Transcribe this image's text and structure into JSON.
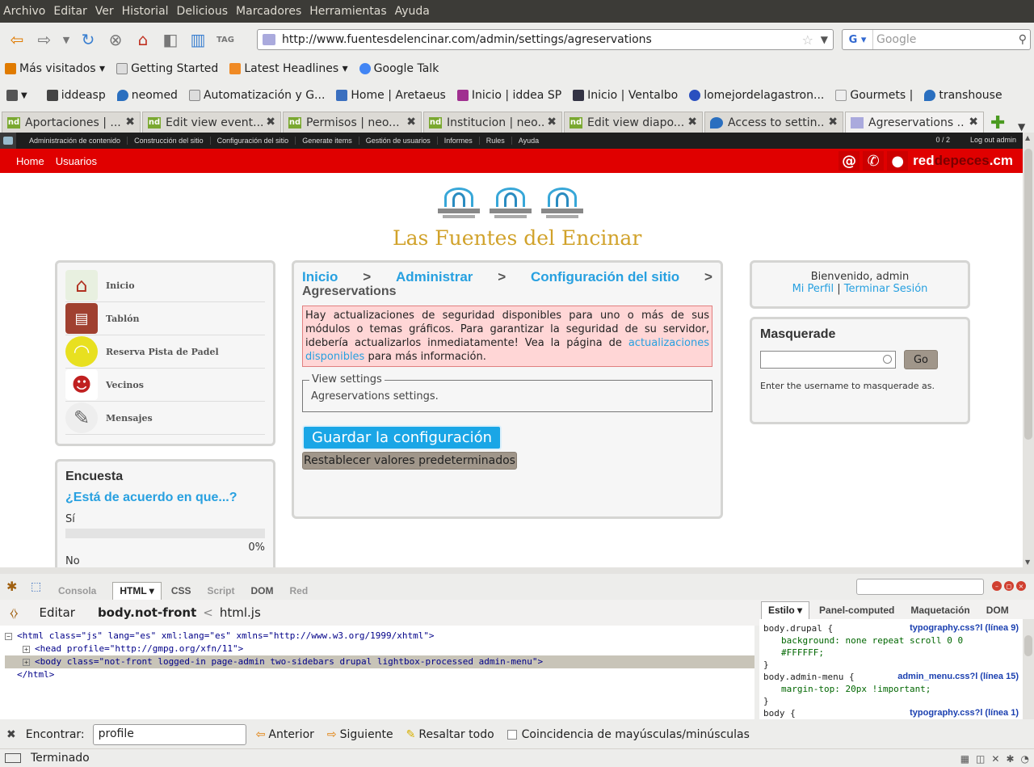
{
  "menubar": [
    "Archivo",
    "Editar",
    "Ver",
    "Historial",
    "Delicious",
    "Marcadores",
    "Herramientas",
    "Ayuda"
  ],
  "url": "http://www.fuentesdelencinar.com/admin/settings/agreservations",
  "search_placeholder": "Google",
  "bookmarks_row1": [
    "Más visitados ▾",
    "Getting Started",
    "Latest Headlines ▾",
    "Google Talk"
  ],
  "bookmarks_row2": [
    "iddeasp",
    "neomed",
    "Automatización y G...",
    "Home | Aretaeus",
    "Inicio | iddea SP",
    "Inicio | Ventalbo",
    "lomejordelagastron...",
    "Gourmets |",
    "transhouse"
  ],
  "tabs": [
    {
      "label": "Aportaciones | ...",
      "icon": "nd"
    },
    {
      "label": "Edit view event...",
      "icon": "nd"
    },
    {
      "label": "Permisos | neo...",
      "icon": "nd"
    },
    {
      "label": "Institucion | neo...",
      "icon": "nd"
    },
    {
      "label": "Edit view diapo...",
      "icon": "nd"
    },
    {
      "label": "Access to settin...",
      "icon": "drupal"
    },
    {
      "label": "Agreservations ...",
      "icon": "site"
    }
  ],
  "admin_menu": {
    "items": [
      "Administración de contenido",
      "Construcción del sitio",
      "Configuración del sitio",
      "Generate items",
      "Gestión de usuarios",
      "Informes",
      "Rules",
      "Ayuda"
    ],
    "user_count": "0 / 2",
    "logout": "Log out admin"
  },
  "red_nav": [
    "Home",
    "Usuarios"
  ],
  "brand": {
    "symbols": [
      "@",
      "✆",
      "●"
    ],
    "name_a": "red",
    "name_b": "depeces",
    "name_c": ".c",
    "name_d": "m"
  },
  "site_name": "Las Fuentes del Encinar",
  "left_nav": [
    "Inicio",
    "Tablón",
    "Reserva Pista de Padel",
    "Vecinos",
    "Mensajes"
  ],
  "poll": {
    "title": "Encuesta",
    "question": "¿Está de acuerdo en que...?",
    "options": [
      {
        "label": "Sí",
        "pct_text": "0%",
        "pct": 0
      },
      {
        "label": "No"
      }
    ]
  },
  "breadcrumb": [
    "Inicio",
    ">",
    "Administrar",
    ">",
    "Configuración del sitio",
    ">"
  ],
  "page_title": "Agreservations",
  "alert": {
    "text": "Hay actualizaciones de seguridad disponibles para uno o más de sus módulos o temas gráficos. Para garantizar la seguridad de su servidor, idebería actualizarlos inmediatamente! Vea la página de ",
    "link": "actualizaciones disponibles",
    "tail": " para más información."
  },
  "fieldset": {
    "legend": "View settings",
    "body": "Agreservations settings."
  },
  "buttons": {
    "save": "Guardar la configuración",
    "reset": "Restablecer valores predeterminados"
  },
  "welcome": {
    "text": "Bienvenido, admin",
    "profile": "Mi Perfil",
    "sep": "|",
    "logout": "Terminar Sesión"
  },
  "masquerade": {
    "title": "Masquerade",
    "go": "Go",
    "help": "Enter the username to masquerade as."
  },
  "firebug": {
    "tabs": [
      "Consola",
      "HTML ▾",
      "CSS",
      "Script",
      "DOM",
      "Red"
    ],
    "edit": "Editar",
    "path_selected": "body.not-front",
    "path_sep": "<",
    "path_parent": "html.js",
    "style_tabs": [
      "Estilo ▾",
      "Panel-computed",
      "Maquetación",
      "DOM"
    ],
    "html_lines": [
      {
        "tog": "−",
        "code": "<html class=\"js\" lang=\"es\" xml:lang=\"es\" xmlns=\"http://www.w3.org/1999/xhtml\">"
      },
      {
        "tog": "+",
        "code": "<head profile=\"http://gmpg.org/xfn/11\">"
      },
      {
        "tog": "+",
        "code": "<body class=\"not-front logged-in page-admin two-sidebars drupal lightbox-processed admin-menu\">"
      },
      {
        "tog": "",
        "code": "</html>"
      }
    ],
    "style_rules": [
      {
        "selector": "body.drupal {",
        "source": "typography.css?l (línea 9)",
        "props": [
          "background: none repeat scroll 0 0",
          "#FFFFFF;"
        ]
      },
      {
        "selector": "}",
        "source": "",
        "props": []
      },
      {
        "selector": "body.admin-menu {",
        "source": "admin_menu.css?l (línea 15)",
        "props": [
          "margin-top: 20px !important;"
        ]
      },
      {
        "selector": "}",
        "source": "",
        "props": []
      },
      {
        "selector": "body {",
        "source": "typography.css?l (línea 1)",
        "props": []
      }
    ]
  },
  "findbar": {
    "label": "Encontrar:",
    "value": "profile",
    "prev": "Anterior",
    "next": "Siguiente",
    "highlight": "Resaltar todo",
    "case": "Coincidencia de mayúsculas/minúsculas"
  },
  "status": "Terminado"
}
